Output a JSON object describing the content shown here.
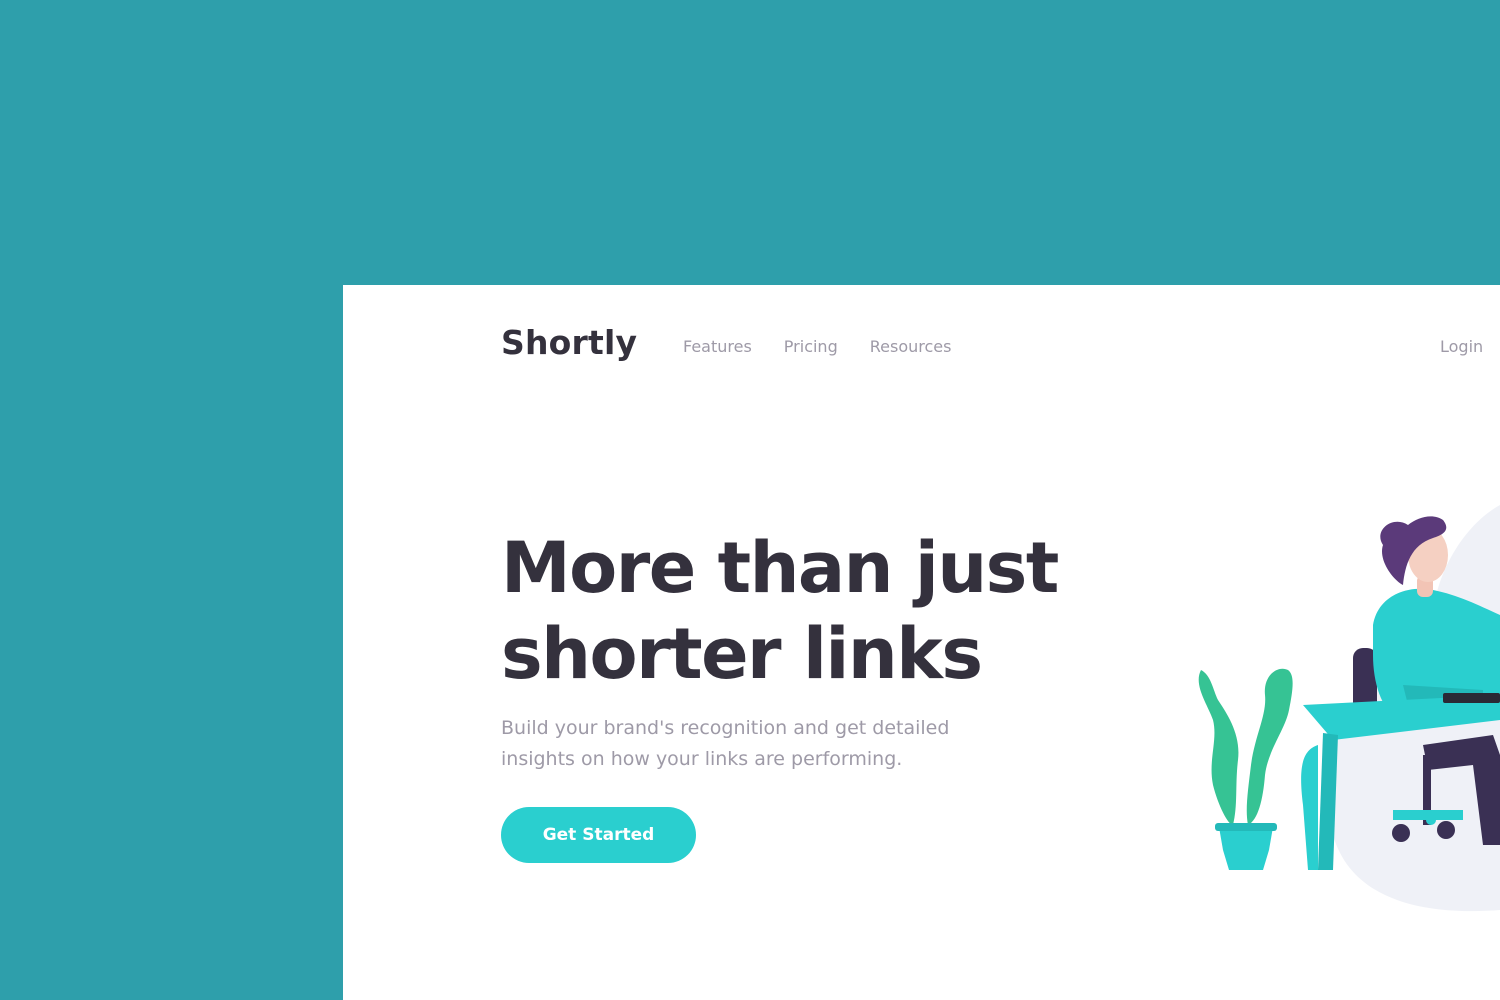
{
  "brand": {
    "name": "Shortly"
  },
  "nav": {
    "items": [
      {
        "label": "Features"
      },
      {
        "label": "Pricing"
      },
      {
        "label": "Resources"
      }
    ],
    "login_label": "Login"
  },
  "hero": {
    "headline": "More than just shorter links",
    "subtitle": "Build your brand's recognition and get detailed insights on how your links are performing.",
    "cta_label": "Get Started"
  },
  "colors": {
    "backdrop": "#2e9fab",
    "page": "#ffffff",
    "accent": "#2acfcf",
    "heading": "#34313d",
    "muted": "#9e9aa7",
    "plant": "#36c394",
    "chair": "#3a3054",
    "hair": "#5b3a7a",
    "blob": "#eff1f7"
  },
  "illustration": {
    "icon": "person-working-at-desk-illustration"
  }
}
